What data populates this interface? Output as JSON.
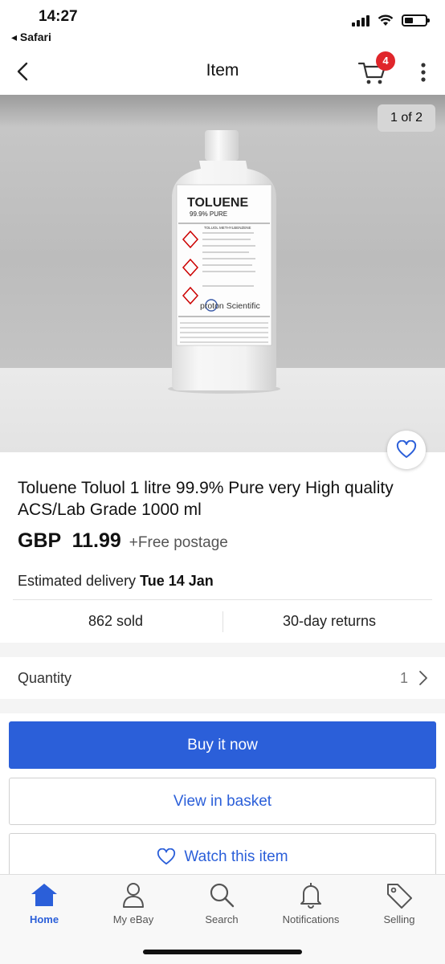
{
  "status_bar": {
    "time": "14:27",
    "back_app": "◂ Safari",
    "battery_level": 0.4
  },
  "nav": {
    "title": "Item",
    "cart_count": "4"
  },
  "gallery": {
    "counter": "1 of 2"
  },
  "product_label": {
    "name": "TOLUENE",
    "purity": "99.9% PURE",
    "synonyms": "TOLUOL METHYLBENZENE",
    "brand": "proton Scientific"
  },
  "product": {
    "title": "Toluene Toluol 1 litre 99.9% Pure very High quality ACS/Lab Grade 1000 ml",
    "price": "GBP  11.99",
    "postage": "+Free postage",
    "delivery_label": "Estimated delivery",
    "delivery_date": "Tue 14 Jan",
    "sold": "862 sold",
    "returns": "30-day returns"
  },
  "quantity": {
    "label": "Quantity",
    "value": "1"
  },
  "actions": {
    "buy_now": "Buy it now",
    "view_basket": "View in basket",
    "watch": "Watch this item"
  },
  "tabs": [
    {
      "label": "Home",
      "icon": "home-icon"
    },
    {
      "label": "My eBay",
      "icon": "user-icon"
    },
    {
      "label": "Search",
      "icon": "search-icon"
    },
    {
      "label": "Notifications",
      "icon": "bell-icon"
    },
    {
      "label": "Selling",
      "icon": "tag-icon"
    }
  ],
  "colors": {
    "accent": "#2b5fd9",
    "badge": "#e0262b"
  }
}
